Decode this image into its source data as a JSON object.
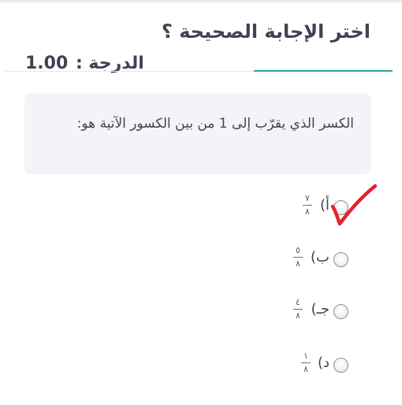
{
  "header": {
    "title": "اختر الإجابة الصحيحة ؟",
    "grade_label": "الدرجة :",
    "grade_value": "1.00"
  },
  "question": {
    "text": "الكسر الذي يقرّب إلى 1 من بين الكسور الآتية هو:"
  },
  "options": [
    {
      "letter": "أ)",
      "numerator": "٧",
      "denominator": "٨",
      "marked_correct": true
    },
    {
      "letter": "ب)",
      "numerator": "٥",
      "denominator": "٨",
      "marked_correct": false
    },
    {
      "letter": "جـ)",
      "numerator": "٤",
      "denominator": "٨",
      "marked_correct": false
    },
    {
      "letter": "د)",
      "numerator": "١",
      "denominator": "٨",
      "marked_correct": false
    }
  ],
  "colors": {
    "accent": "#2aa8a0",
    "checkmark": "#e8202f",
    "question_bg": "#f4f3f7"
  }
}
